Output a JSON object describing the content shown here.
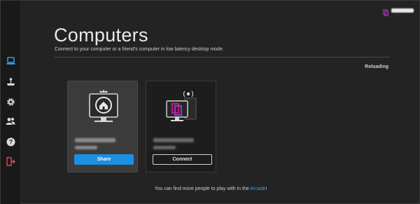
{
  "page": {
    "title": "Computers",
    "subtitle": "Connect to your computer or a friend's computer in low latency desktop mode.",
    "status": "Reloading"
  },
  "sidebar": {
    "items": [
      {
        "icon": "computer-icon",
        "active": true
      },
      {
        "icon": "arcade-icon",
        "active": false
      },
      {
        "icon": "gear-icon",
        "active": false
      },
      {
        "icon": "friends-icon",
        "active": false
      },
      {
        "icon": "help-icon",
        "active": false
      },
      {
        "icon": "logout-icon",
        "active": false
      }
    ]
  },
  "cards": [
    {
      "type": "host",
      "icon": "home-monitor-icon",
      "button_label": "Share"
    },
    {
      "type": "guest",
      "icon": "parsec-monitor-icon",
      "button_label": "Connect"
    }
  ],
  "footer": {
    "text_before": "You can find more people to play with in the ",
    "link_text": "Arcade",
    "text_after": "!"
  },
  "colors": {
    "accent": "#1a8fe3",
    "brand": "#c8196a",
    "background": "#232323"
  }
}
